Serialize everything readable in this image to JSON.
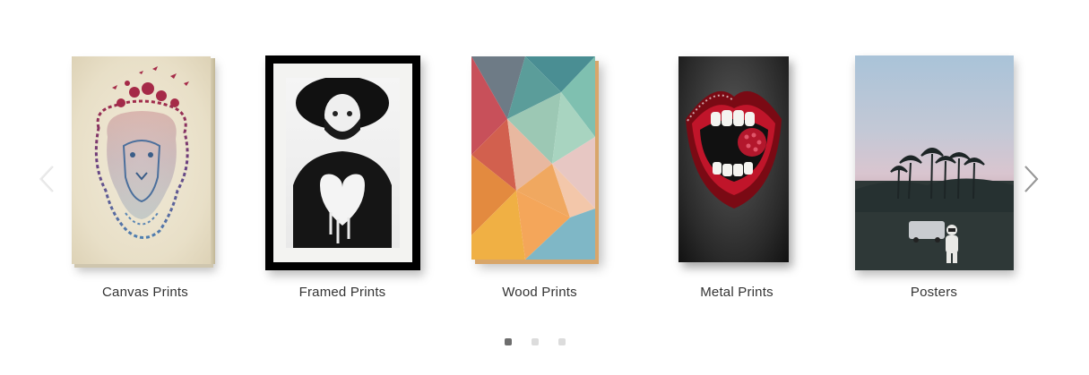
{
  "carousel": {
    "items": [
      {
        "label": "Canvas Prints",
        "image": "lion-with-flower-crown-illustration"
      },
      {
        "label": "Framed Prints",
        "image": "black-and-white-portrait-with-heart"
      },
      {
        "label": "Wood Prints",
        "image": "colorful-low-poly-geometric"
      },
      {
        "label": "Metal Prints",
        "image": "red-lips-with-raspberry"
      },
      {
        "label": "Posters",
        "image": "astronaut-at-dusk-with-palm-trees"
      }
    ],
    "prev_icon": "chevron-left-icon",
    "next_icon": "chevron-right-icon",
    "pagination": {
      "pages": 3,
      "active_index": 0
    }
  }
}
